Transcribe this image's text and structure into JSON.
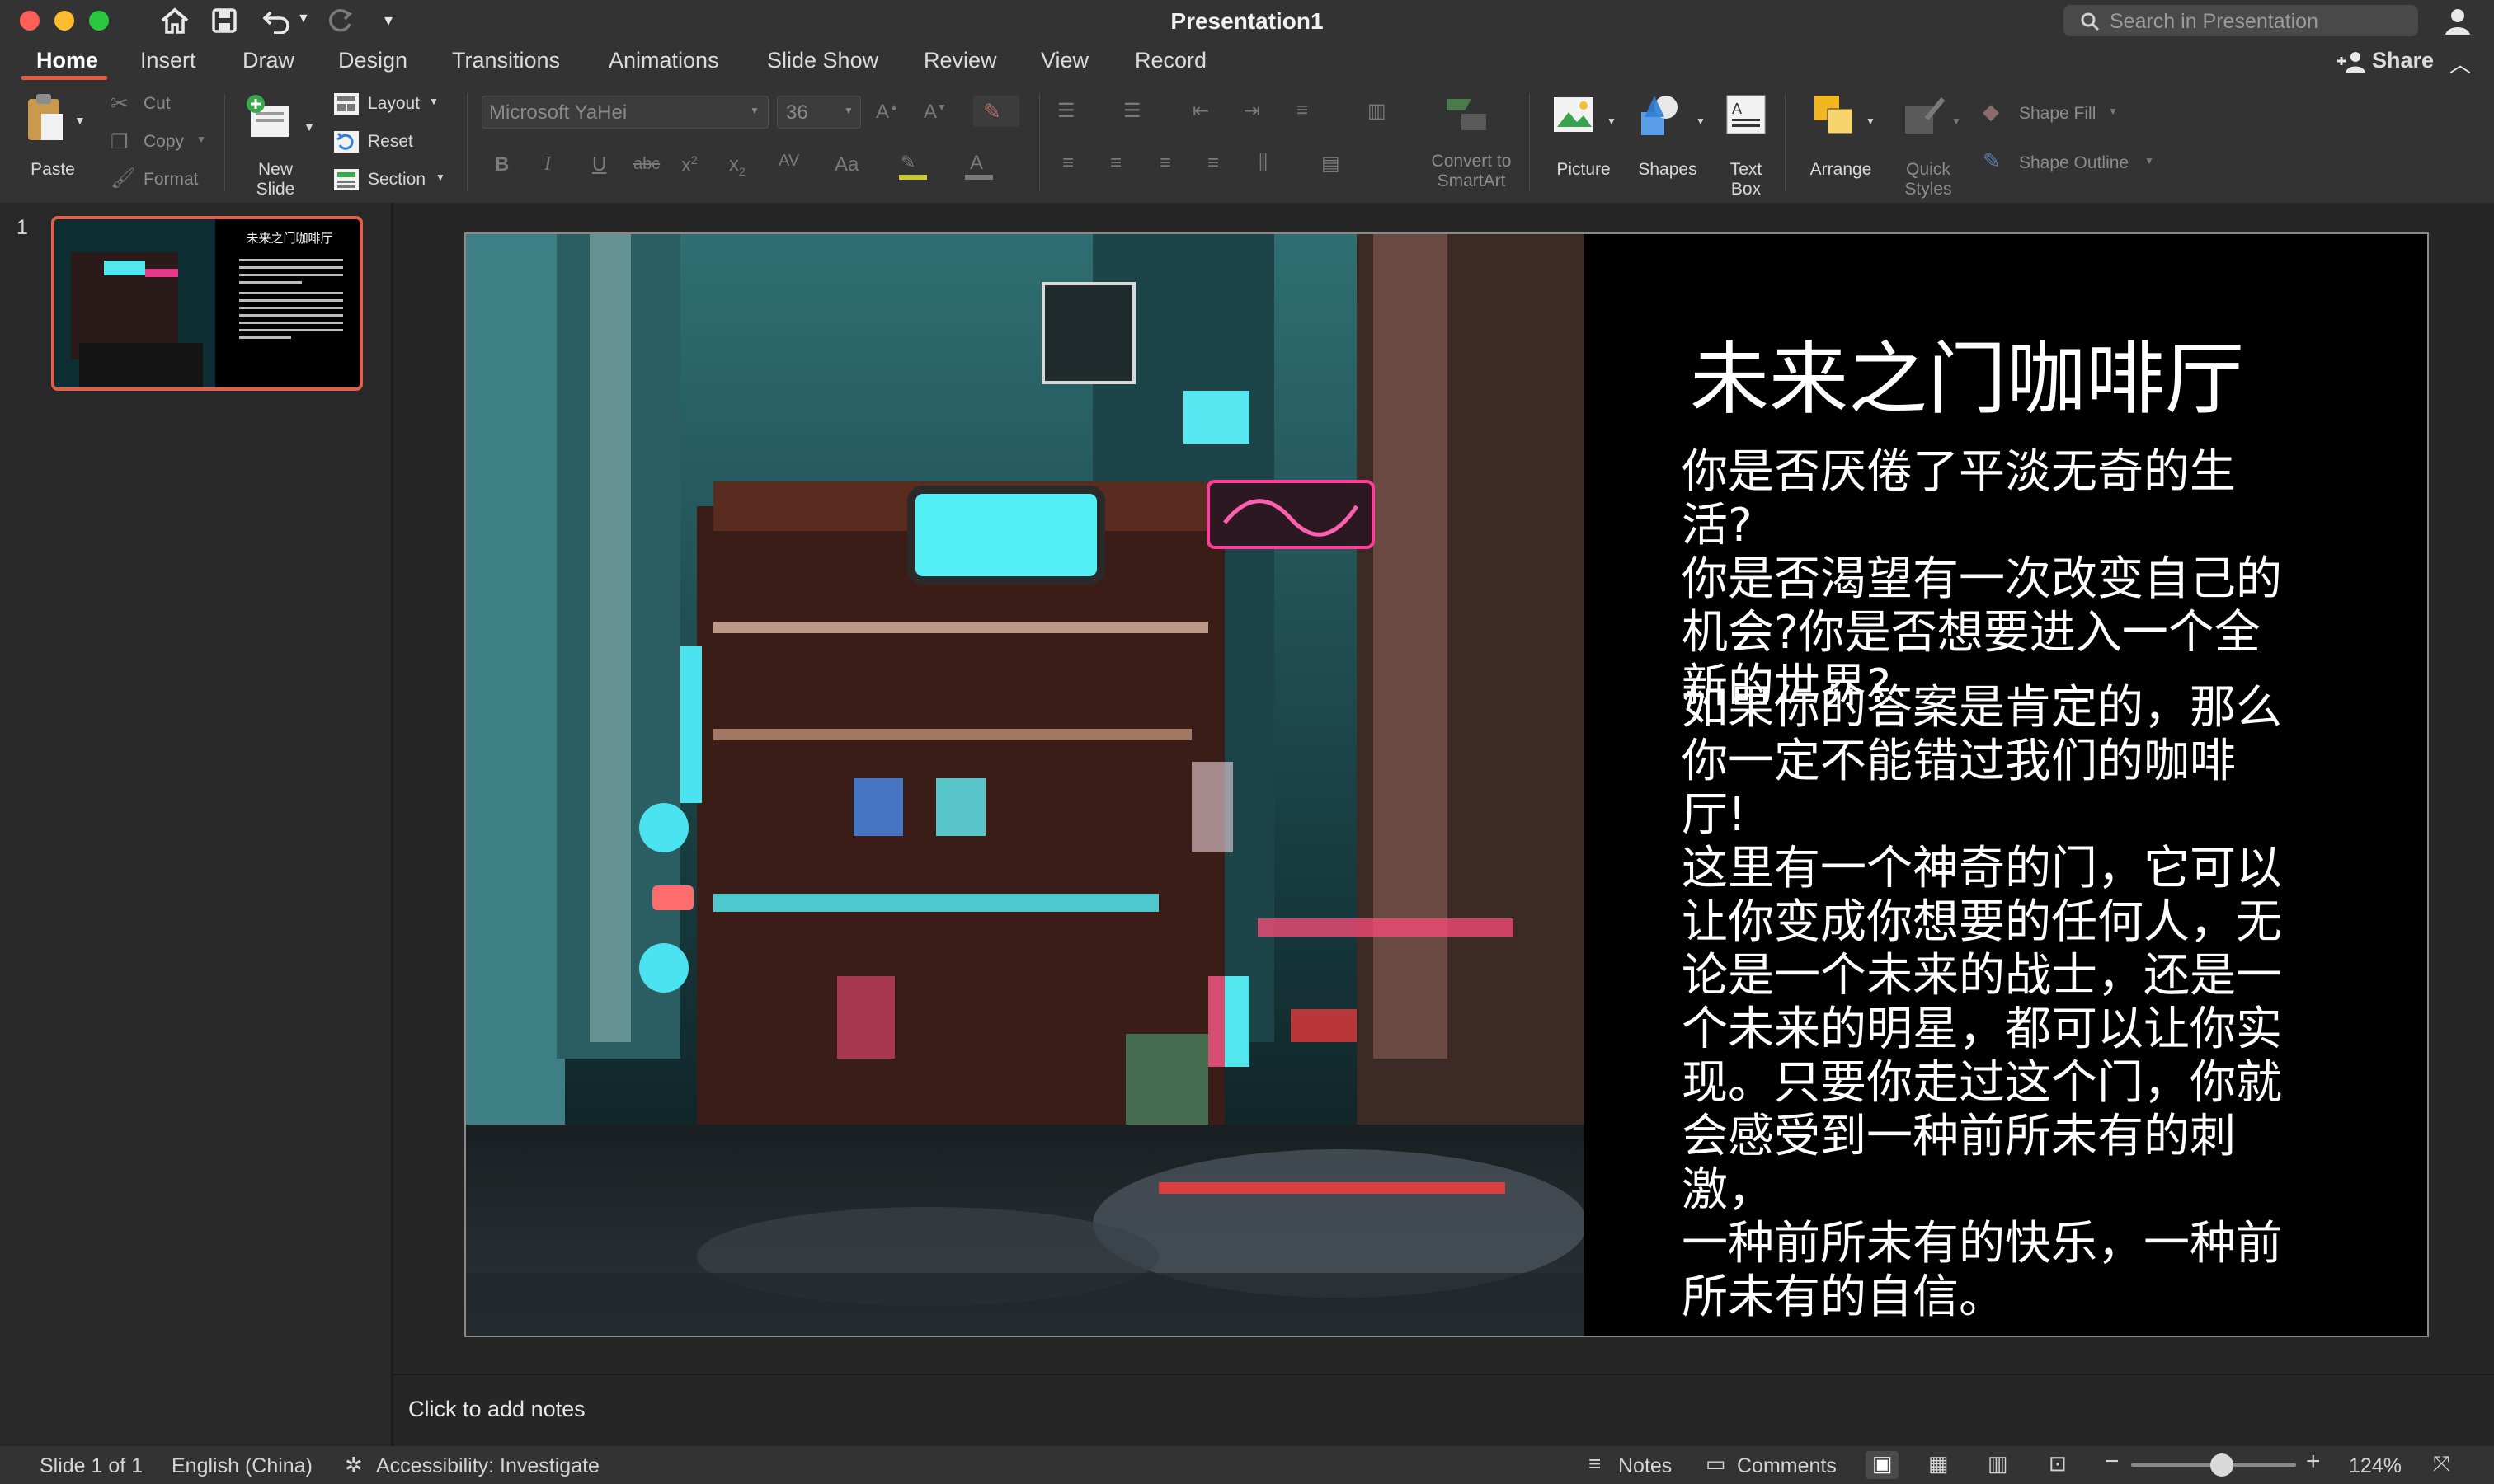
{
  "window": {
    "title": "Presentation1"
  },
  "search": {
    "placeholder": "Search in Presentation"
  },
  "share": {
    "label": "Share"
  },
  "tabs": [
    {
      "label": "Home",
      "active": true
    },
    {
      "label": "Insert"
    },
    {
      "label": "Draw"
    },
    {
      "label": "Design"
    },
    {
      "label": "Transitions"
    },
    {
      "label": "Animations"
    },
    {
      "label": "Slide Show"
    },
    {
      "label": "Review"
    },
    {
      "label": "View"
    },
    {
      "label": "Record"
    }
  ],
  "ribbon": {
    "paste": "Paste",
    "cut": "Cut",
    "copy": "Copy",
    "format": "Format",
    "new_slide_line1": "New",
    "new_slide_line2": "Slide",
    "layout": "Layout",
    "reset": "Reset",
    "section": "Section",
    "font_name": "Microsoft YaHei",
    "font_size": "36",
    "convert_line1": "Convert to",
    "convert_line2": "SmartArt",
    "picture": "Picture",
    "shapes": "Shapes",
    "textbox_line1": "Text",
    "textbox_line2": "Box",
    "arrange": "Arrange",
    "quick_line1": "Quick",
    "quick_line2": "Styles",
    "shape_fill": "Shape Fill",
    "shape_outline": "Shape Outline"
  },
  "thumbnail": {
    "number": "1",
    "title": "未来之门咖啡厅"
  },
  "slide": {
    "title": "未来之门咖啡厅",
    "paragraph1_lines": [
      "你是否厌倦了平淡无奇的生活?",
      "你是否渴望有一次改变自己的",
      "机会?你是否想要进入一个全",
      "新的世界?"
    ],
    "paragraph2_lines": [
      "如果你的答案是肯定的，那么",
      "你一定不能错过我们的咖啡厅!",
      "这里有一个神奇的门，它可以",
      "让你变成你想要的任何人，无",
      "论是一个未来的战士，还是一",
      "个未来的明星，都可以让你实",
      "现。只要你走过这个门，你就",
      "会感受到一种前所未有的刺激，",
      "一种前所未有的快乐，一种前",
      "所未有的自信。"
    ]
  },
  "notes": {
    "placeholder": "Click to add notes"
  },
  "status": {
    "slide_count": "Slide 1 of 1",
    "language": "English (China)",
    "accessibility": "Accessibility: Investigate",
    "notes": "Notes",
    "comments": "Comments",
    "zoom": "124%",
    "zoom_fraction": 0.55
  },
  "colors": {
    "accent": "#e25c43",
    "background": "#262626",
    "chrome": "#333333"
  }
}
